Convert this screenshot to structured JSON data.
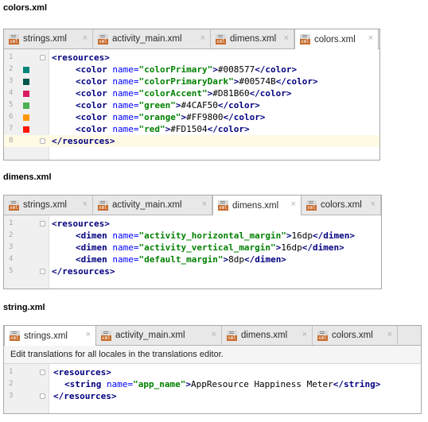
{
  "sections": {
    "colors_title": "colors.xml",
    "dimens_title": "dimens.xml",
    "string_title": "string.xml"
  },
  "tabs": {
    "strings": "strings.xml",
    "activity": "activity_main.xml",
    "dimens": "dimens.xml",
    "colors": "colors.xml",
    "close": "×",
    "icon_text": "xml"
  },
  "colors_panel": {
    "lines": [
      "1",
      "2",
      "3",
      "4",
      "5",
      "6",
      "7",
      "8"
    ],
    "open_tag": "<resources>",
    "close_tag": "</resources>",
    "items": [
      {
        "open": "<color ",
        "attr": "name=",
        "name": "\"colorPrimary\"",
        "gt": ">",
        "value": "#008577",
        "close": "</color>",
        "swatch": "#008577"
      },
      {
        "open": "<color ",
        "attr": "name=",
        "name": "\"colorPrimaryDark\"",
        "gt": ">",
        "value": "#00574B",
        "close": "</color>",
        "swatch": "#00574B"
      },
      {
        "open": "<color ",
        "attr": "name=",
        "name": "\"colorAccent\"",
        "gt": ">",
        "value": "#D81B60",
        "close": "</color>",
        "swatch": "#D81B60"
      },
      {
        "open": "<color ",
        "attr": "name=",
        "name": "\"green\"",
        "gt": ">",
        "value": "#4CAF50",
        "close": "</color>",
        "swatch": "#4CAF50"
      },
      {
        "open": "<color ",
        "attr": "name=",
        "name": "\"orange\"",
        "gt": ">",
        "value": "#FF9800",
        "close": "</color>",
        "swatch": "#FF9800"
      },
      {
        "open": "<color ",
        "attr": "name=",
        "name": "\"red\"",
        "gt": ">",
        "value": "#FD1504",
        "close": "</color>",
        "swatch": "#FD1504"
      }
    ]
  },
  "dimens_panel": {
    "lines": [
      "1",
      "2",
      "3",
      "4",
      "5"
    ],
    "open_tag": "<resources>",
    "close_tag": "</resources>",
    "items": [
      {
        "open": "<dimen ",
        "attr": "name=",
        "name": "\"activity_horizontal_margin\"",
        "gt": ">",
        "value": "16dp",
        "close": "</dimen>"
      },
      {
        "open": "<dimen ",
        "attr": "name=",
        "name": "\"activity_vertical_margin\"",
        "gt": ">",
        "value": "16dp",
        "close": "</dimen>"
      },
      {
        "open": "<dimen ",
        "attr": "name=",
        "name": "\"default_margin\"",
        "gt": ">",
        "value": "8dp",
        "close": "</dimen>"
      }
    ]
  },
  "strings_panel": {
    "notice": "Edit translations for all locales in the translations editor.",
    "lines": [
      "1",
      "2",
      "3"
    ],
    "open_tag": "<resources>",
    "close_tag": "</resources>",
    "items": [
      {
        "open": "<string ",
        "attr": "name=",
        "name": "\"app_name\"",
        "gt": ">",
        "value": "AppResource Happiness Meter",
        "close": "</string>"
      }
    ]
  }
}
